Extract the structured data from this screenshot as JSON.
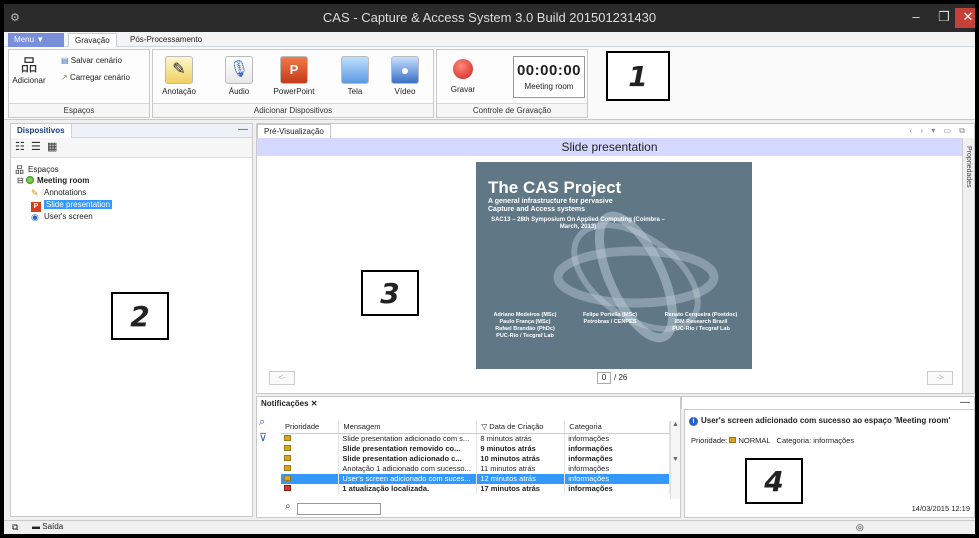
{
  "window": {
    "title": "CAS - Capture & Access System 3.0 Build 201501231430",
    "minimize": "–",
    "maximize": "❐",
    "close": "✕"
  },
  "tabs": {
    "menu": "Menu ▼",
    "gravacao": "Gravação",
    "pos": "Pós-Processamento"
  },
  "ribbon": {
    "espacos": {
      "title": "Espaços",
      "add": "Adicionar",
      "save": "Salvar cenário",
      "load": "Carregar cenário"
    },
    "devices": {
      "title": "Adicionar Dispositivos",
      "items": [
        "Anotação",
        "Áudio",
        "PowerPoint",
        "Tela",
        "Vídeo"
      ]
    },
    "recording": {
      "title": "Controle de Gravação",
      "record": "Gravar",
      "time": "00:00:00",
      "room": "Meeting room"
    }
  },
  "callouts": [
    "1",
    "2",
    "3",
    "4"
  ],
  "devices_panel": {
    "title": "Dispositivos",
    "tree": {
      "root": "Espaços",
      "room": "Meeting room",
      "items": [
        "Annotations",
        "Slide presentation",
        "User's screen"
      ]
    }
  },
  "preview": {
    "tab": "Pré-Visualização",
    "slide_title": "Slide presentation",
    "properties": "Propriedades",
    "prev": "<-",
    "next": "->",
    "page": "0",
    "total": "/ 26",
    "slide": {
      "title": "The CAS Project",
      "subtitle": "A general infrastructure for pervasive Capture and Access systems",
      "conference": "SAC13 – 28th Symposium On Applied Computing (Coimbra – March, 2013)",
      "authors1": "Adriano Medeiros (MSc)\nPaulo França (MSc)\nRafael Brandão (PhDc)\nPUC-Rio / Tecgraf Lab",
      "authors2": "Felipe Portella (MSc)\nPetrobras / CENPES",
      "authors3": "Renato Cerqueira (Postdoc)\nIBM Research Brazil\nPUC-Rio / Tecgraf Lab"
    }
  },
  "notifications": {
    "tab": "Notificações ✕",
    "columns": [
      "Prioridade",
      "Mensagem",
      "▽ Data de Criação",
      "Categoria"
    ],
    "rows": [
      {
        "msg": "Slide presentation adicionado com s...",
        "date": "8 minutos atrás",
        "cat": "informações",
        "bold": false,
        "hl": false
      },
      {
        "msg": "Slide presentation removido co...",
        "date": "9 minutos atrás",
        "cat": "informações",
        "bold": true,
        "hl": false
      },
      {
        "msg": "Slide presentation adicionado c...",
        "date": "10 minutos atrás",
        "cat": "informações",
        "bold": true,
        "hl": false
      },
      {
        "msg": "Anotação 1 adicionado com sucesso...",
        "date": "11 minutos atrás",
        "cat": "informações",
        "bold": false,
        "hl": false
      },
      {
        "msg": "User's screen adicionado com suces...",
        "date": "12 minutos atrás",
        "cat": "informações",
        "bold": false,
        "hl": true
      },
      {
        "msg": "1 atualização localizada.",
        "date": "17 minutos atrás",
        "cat": "informações",
        "bold": true,
        "hl": false
      }
    ]
  },
  "detail": {
    "header": "User's screen adicionado com sucesso ao espaço 'Meeting room'",
    "priority_label": "Prioridade:",
    "priority": "NORMAL",
    "category_label": "Categoria:",
    "category": "informações",
    "timestamp": "14/03/2015 12:19"
  },
  "statusbar": {
    "exit": "Saída"
  },
  "colors": {
    "menu_accent": "#7a8fd9",
    "selection": "#3399ff",
    "slide_bg": "#607786",
    "close_red": "#c4413a"
  }
}
